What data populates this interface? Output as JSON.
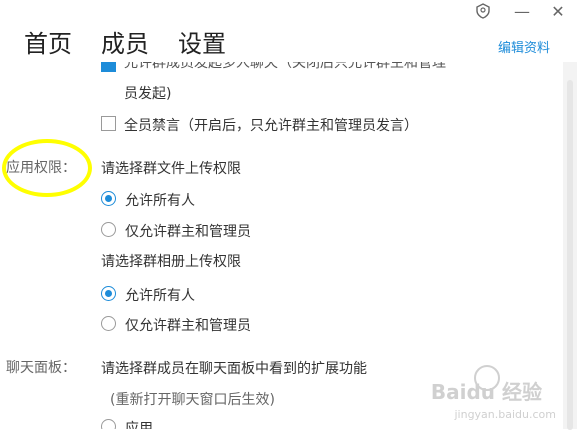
{
  "nav": {
    "tabs": [
      {
        "label": "首页"
      },
      {
        "label": "成员"
      },
      {
        "label": "设置"
      }
    ],
    "edit_link": "编辑资料"
  },
  "window_controls": {
    "shield": "shield-icon",
    "minimize": "—",
    "close": "✕"
  },
  "settings": {
    "partial_top_line": "允许群成员发起多人聊天（关闭后只允许群主和管理",
    "partial_second_line": "员发起)",
    "mute_all": "全员禁言（开启后，只允许群主和管理员发言）",
    "app_permissions": {
      "label": "应用权限：",
      "file_upload_title": "请选择群文件上传权限",
      "file_upload_options": [
        "允许所有人",
        "仅允许群主和管理员"
      ],
      "album_upload_title": "请选择群相册上传权限",
      "album_upload_options": [
        "允许所有人",
        "仅允许群主和管理员"
      ]
    },
    "chat_panel": {
      "label": "聊天面板：",
      "title": "请选择群成员在聊天面板中看到的扩展功能",
      "note": "(重新打开聊天窗口后生效)",
      "partial_option": "应用"
    }
  },
  "watermark": {
    "main": "Baidu 经验",
    "sub": "jingyan.baidu.com"
  },
  "colors": {
    "accent": "#1d8cd9",
    "highlight": "#ffff00"
  }
}
